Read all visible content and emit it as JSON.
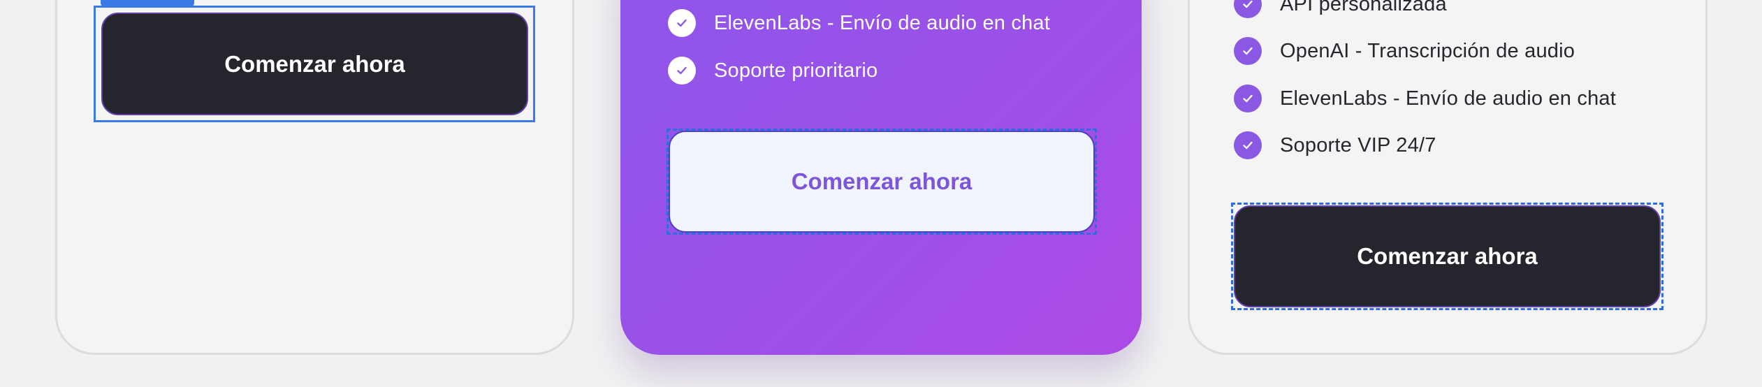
{
  "plans": {
    "left": {
      "button_label": "Comenzar ahora"
    },
    "middle": {
      "features": [
        "ElevenLabs - Envío de audio en chat",
        "Soporte prioritario"
      ],
      "button_label": "Comenzar ahora"
    },
    "right": {
      "features": [
        "API personalizada",
        "OpenAI - Transcripción de audio",
        "ElevenLabs - Envío de audio en chat",
        "Soporte VIP 24/7"
      ],
      "button_label": "Comenzar ahora"
    }
  },
  "icons": {
    "feature_check": "check-icon"
  },
  "colors": {
    "accent_purple": "#8a58e3",
    "gradient_start": "#8d56ea",
    "gradient_end": "#ad4ae6",
    "dark_button": "#25262d",
    "selection_blue": "#3a7be6"
  }
}
